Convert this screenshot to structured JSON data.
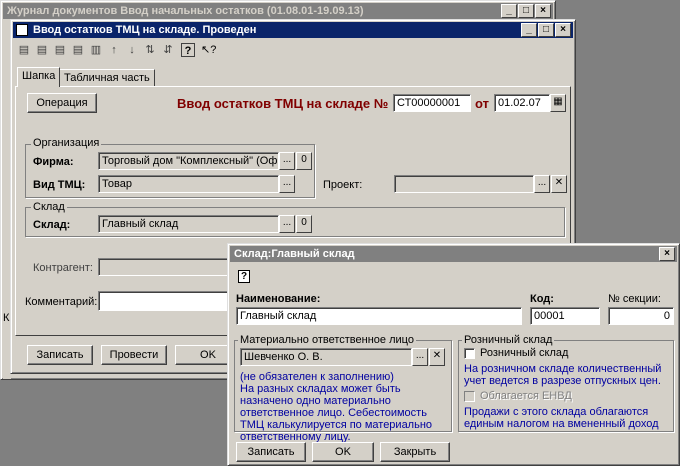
{
  "journal": {
    "title": "Журнал документов  Ввод начальных остатков (01.08.01-19.09.13)"
  },
  "doc": {
    "title": "Ввод остатков ТМЦ на складе. Проведен",
    "tabs": [
      "Шапка",
      "Табличная часть"
    ],
    "operation_button": "Операция",
    "heading": "Ввод остатков ТМЦ на складе №",
    "doc_number": "СТ00000001",
    "date_label": "от",
    "doc_date": "01.02.07",
    "org_group": "Организация",
    "firm_label": "Фирма:",
    "firm_value": "Торговый дом \"Комплексный\" (Офис)",
    "tmc_type_label": "Вид ТМЦ:",
    "tmc_type_value": "Товар",
    "project_label": "Проект:",
    "project_value": "",
    "warehouse_group": "Склад",
    "warehouse_label": "Склад:",
    "warehouse_value": "Главный склад",
    "counterparty_label": "Контрагент:",
    "comment_label": "Комментарий:",
    "save_button": "Записать",
    "post_button": "Провести",
    "ok_button": "OK",
    "left_edge_char": "К"
  },
  "warehouse_dialog": {
    "title": "Склад:Главный склад",
    "help_icon": "?",
    "name_label": "Наименование:",
    "name_value": "Главный склад",
    "code_label": "Код:",
    "code_value": "00001",
    "section_label": "№ секции:",
    "section_value": "0",
    "mol_group": "Материально ответственное лицо",
    "mol_value": "Шевченко О. В.",
    "mol_note1": "(не обязателен к заполнению)",
    "mol_note2": "На разных складах может быть назначено одно материально ответственное лицо. Себестоимость ТМЦ калькулируется по материально ответственному лицу.",
    "retail_group": "Розничный склад",
    "retail_checkbox": "Розничный склад",
    "retail_note": "На розничном складе количественный учет ведется в разрезе отпускных цен.",
    "envd_checkbox": "Облагается ЕНВД",
    "envd_note": "Продажи с этого склада облагаются единым налогом на вмененный доход",
    "save_button": "Записать",
    "ok_button": "OK",
    "close_button": "Закрыть"
  },
  "colors": {
    "title_active": "#0a246a",
    "heading": "#800000",
    "note_blue": "#0000a0",
    "face": "#d4d0c8"
  }
}
